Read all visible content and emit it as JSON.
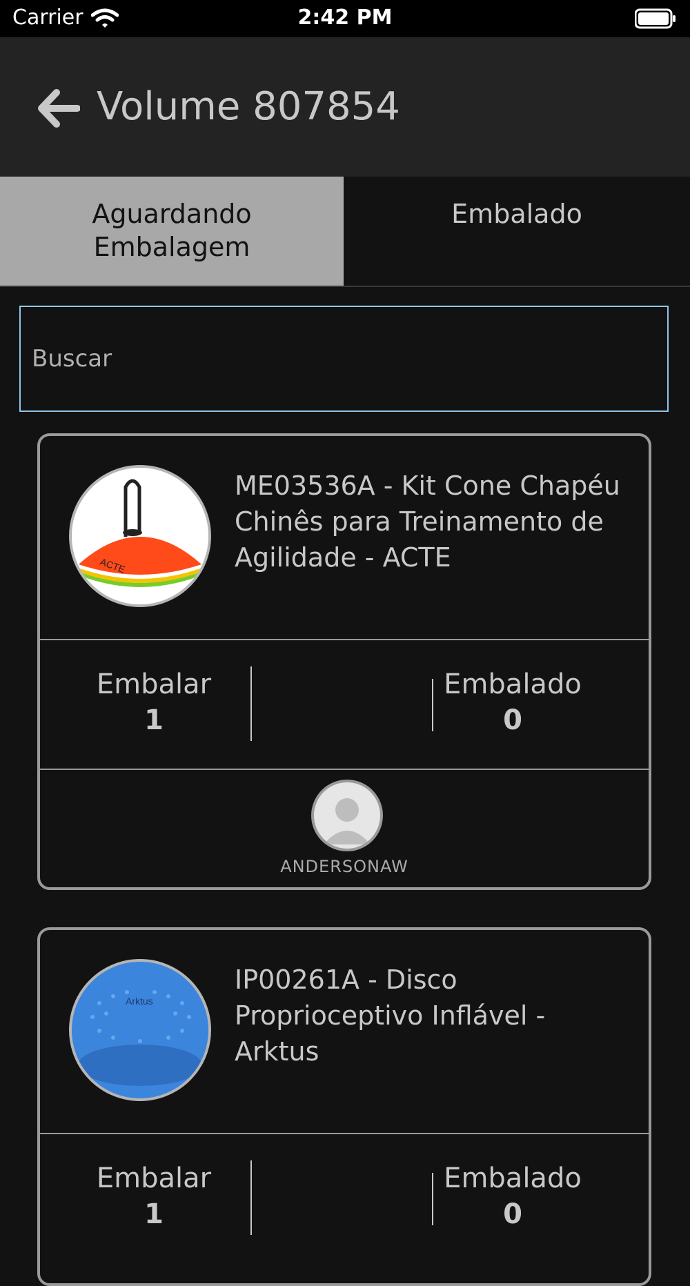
{
  "status_bar": {
    "carrier": "Carrier",
    "time": "2:42 PM"
  },
  "header": {
    "title": "Volume 807854"
  },
  "tabs": [
    {
      "label": "Aguardando Embalagem",
      "active": true
    },
    {
      "label": "Embalado",
      "active": false
    }
  ],
  "search": {
    "placeholder": "Buscar",
    "value": ""
  },
  "items": [
    {
      "name": "ME03536A - Kit Cone Chapéu Chinês para Treinamento de Agilidade - ACTE",
      "thumb_icon": "cone-product-image",
      "embalar_label": "Embalar",
      "embalar_value": "1",
      "embalado_label": "Embalado",
      "embalado_value": "0",
      "user": "ANDERSONAW"
    },
    {
      "name": "IP00261A - Disco Proprioceptivo Inflável - Arktus",
      "thumb_icon": "disc-product-image",
      "embalar_label": "Embalar",
      "embalar_value": "1",
      "embalado_label": "Embalado",
      "embalado_value": "0"
    }
  ],
  "colors": {
    "background": "#121212",
    "header": "#232323",
    "tab_active": "#a8a8a8",
    "search_border": "#8fc6e8",
    "card_border": "#9a9a9a"
  }
}
